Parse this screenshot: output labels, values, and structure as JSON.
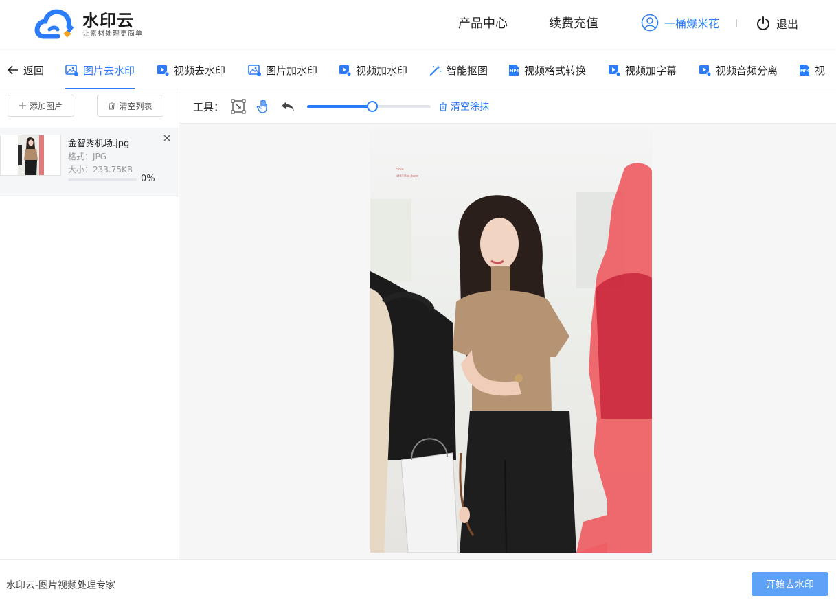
{
  "header": {
    "logo_name": "水印云",
    "logo_slogan": "让素材处理更简单",
    "nav": [
      {
        "label": "产品中心"
      },
      {
        "label": "续费充值"
      }
    ],
    "user_name": "一桶爆米花",
    "logout_label": "退出",
    "accent_color": "#2b7cf6"
  },
  "tabs": {
    "back_label": "返回",
    "items": [
      {
        "label": "图片去水印",
        "icon": "image-icon",
        "active": true
      },
      {
        "label": "视频去水印",
        "icon": "video-icon"
      },
      {
        "label": "图片加水印",
        "icon": "image-icon"
      },
      {
        "label": "视频加水印",
        "icon": "video-icon"
      },
      {
        "label": "智能抠图",
        "icon": "magic-wand-icon"
      },
      {
        "label": "视频格式转换",
        "icon": "mp4-file-icon"
      },
      {
        "label": "视频加字幕",
        "icon": "video-icon"
      },
      {
        "label": "视频音频分离",
        "icon": "video-icon"
      },
      {
        "label": "视",
        "icon": "mp4-file-icon"
      }
    ]
  },
  "left_panel": {
    "add_image_label": "添加图片",
    "clear_list_label": "清空列表",
    "file": {
      "name": "金智秀机场.jpg",
      "format": "格式：JPG",
      "size": "大小：233.75KB",
      "progress": 0,
      "progress_text": "0%"
    }
  },
  "toolbar": {
    "label": "工具：",
    "tools": [
      "select-area-icon",
      "hand-icon",
      "undo-icon"
    ],
    "brush_size_fraction": 0.53,
    "clear_paint_label": "清空涂抹"
  },
  "footer": {
    "text": "水印云-图片视频处理专家",
    "start_label": "开始去水印"
  }
}
